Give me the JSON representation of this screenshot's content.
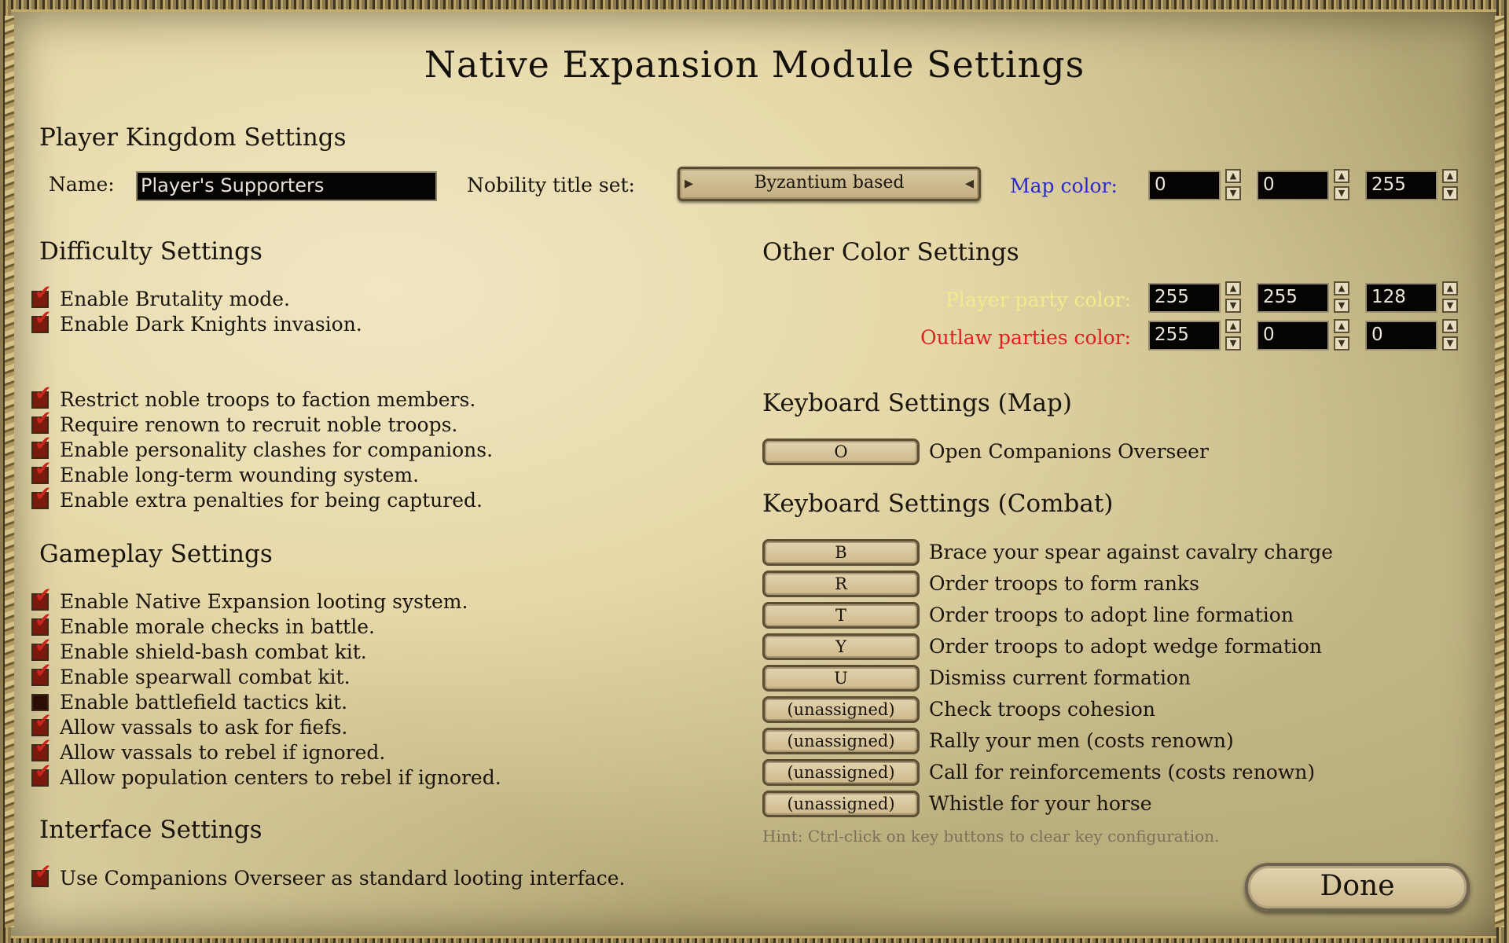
{
  "title": "Native Expansion Module Settings",
  "player_kingdom": {
    "heading": "Player Kingdom Settings",
    "name_label": "Name:",
    "name_value": "Player's Supporters",
    "nobility_label": "Nobility title set:",
    "nobility_value": "Byzantium based",
    "map_color_label": "Map color:",
    "map_color_label_color": "#2a2ac8",
    "map_color": [
      "0",
      "0",
      "255"
    ]
  },
  "other_colors": {
    "heading": "Other Color Settings",
    "player_party_label": "Player party color:",
    "player_party_label_color": "#f0ec8a",
    "player_party_color": [
      "255",
      "255",
      "128"
    ],
    "outlaw_label": "Outlaw parties color:",
    "outlaw_label_color": "#e02020",
    "outlaw_color": [
      "255",
      "0",
      "0"
    ]
  },
  "difficulty": {
    "heading": "Difficulty Settings",
    "items": [
      {
        "label": "Enable Brutality mode.",
        "checked": true
      },
      {
        "label": "Enable Dark Knights invasion.",
        "checked": true
      },
      {
        "label": "Restrict noble troops to faction members.",
        "checked": true
      },
      {
        "label": "Require renown to recruit noble troops.",
        "checked": true
      },
      {
        "label": "Enable personality clashes for companions.",
        "checked": true
      },
      {
        "label": "Enable long-term wounding system.",
        "checked": true
      },
      {
        "label": "Enable extra penalties for being captured.",
        "checked": true
      }
    ]
  },
  "gameplay": {
    "heading": "Gameplay Settings",
    "items": [
      {
        "label": "Enable Native Expansion looting system.",
        "checked": true
      },
      {
        "label": "Enable morale checks in battle.",
        "checked": true
      },
      {
        "label": "Enable shield-bash combat kit.",
        "checked": true
      },
      {
        "label": "Enable spearwall combat kit.",
        "checked": true
      },
      {
        "label": "Enable battlefield tactics kit.",
        "checked": false
      },
      {
        "label": "Allow vassals to ask for fiefs.",
        "checked": true
      },
      {
        "label": "Allow vassals to rebel if ignored.",
        "checked": true
      },
      {
        "label": "Allow population centers to rebel if ignored.",
        "checked": true
      }
    ]
  },
  "interface": {
    "heading": "Interface Settings",
    "items": [
      {
        "label": "Use Companions Overseer as standard looting interface.",
        "checked": true
      }
    ]
  },
  "keyboard_map": {
    "heading": "Keyboard Settings (Map)",
    "bindings": [
      {
        "key": "O",
        "action": "Open Companions Overseer"
      }
    ]
  },
  "keyboard_combat": {
    "heading": "Keyboard Settings (Combat)",
    "bindings": [
      {
        "key": "B",
        "action": "Brace your spear against cavalry charge"
      },
      {
        "key": "R",
        "action": "Order troops to form ranks"
      },
      {
        "key": "T",
        "action": "Order troops to adopt line formation"
      },
      {
        "key": "Y",
        "action": "Order troops to adopt wedge formation"
      },
      {
        "key": "U",
        "action": "Dismiss current formation"
      },
      {
        "key": "(unassigned)",
        "action": "Check troops cohesion"
      },
      {
        "key": "(unassigned)",
        "action": "Rally your men (costs renown)"
      },
      {
        "key": "(unassigned)",
        "action": "Call for reinforcements (costs renown)"
      },
      {
        "key": "(unassigned)",
        "action": "Whistle for your horse"
      }
    ]
  },
  "hint": "Hint: Ctrl-click on key buttons to clear key configuration.",
  "done_label": "Done",
  "icons": {
    "up": "▲",
    "down": "▼",
    "check": "✔",
    "left_arrow": "◂",
    "right_arrow": "▸"
  }
}
